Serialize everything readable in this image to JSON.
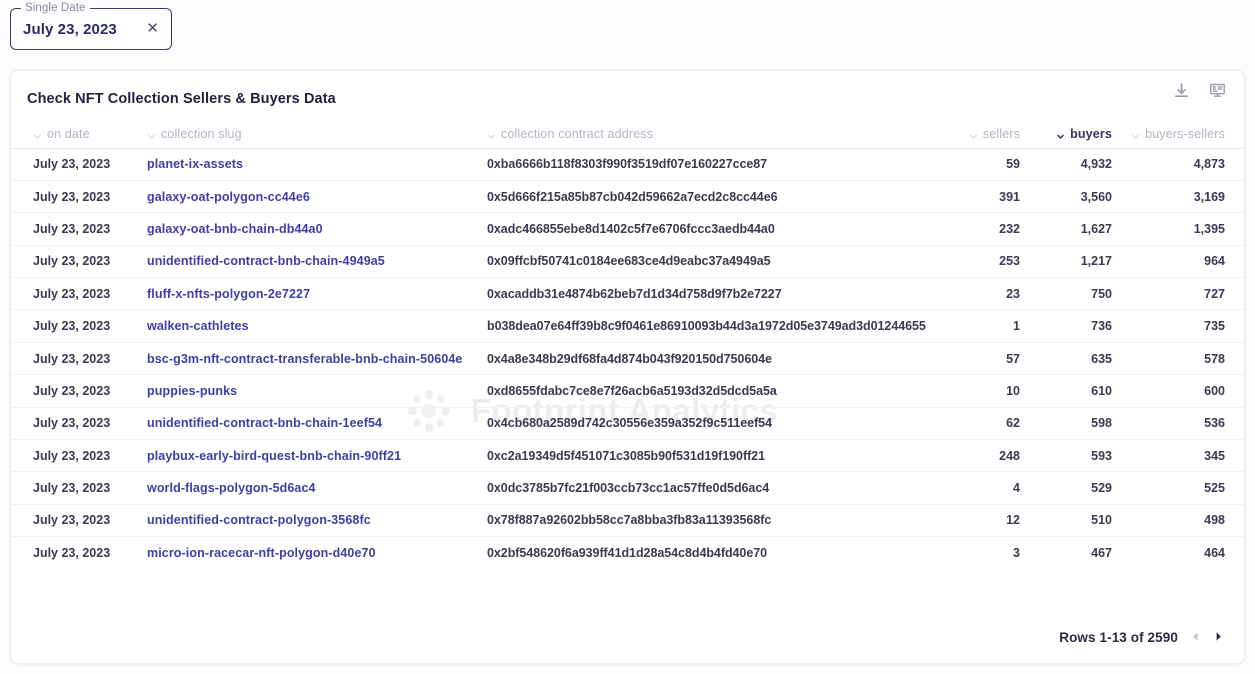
{
  "date_filter": {
    "label": "Single Date",
    "value": "July 23, 2023",
    "clear_icon": "close-icon"
  },
  "card": {
    "title": "Check NFT Collection Sellers & Buyers Data",
    "actions": [
      {
        "name": "download-icon",
        "title": "Download"
      },
      {
        "name": "api-screen-icon",
        "title": "API"
      }
    ]
  },
  "table": {
    "columns": [
      {
        "key": "on_date",
        "label": "on date",
        "align": "left",
        "sorted": false
      },
      {
        "key": "collection_slug",
        "label": "collection slug",
        "align": "left",
        "sorted": false
      },
      {
        "key": "collection_contract_address",
        "label": "collection contract address",
        "align": "left",
        "sorted": false
      },
      {
        "key": "sellers",
        "label": "sellers",
        "align": "right",
        "sorted": false
      },
      {
        "key": "buyers",
        "label": "buyers",
        "align": "right",
        "sorted": true
      },
      {
        "key": "buyers_sellers",
        "label": "buyers-sellers",
        "align": "right",
        "sorted": false
      }
    ],
    "rows": [
      {
        "on_date": "July 23, 2023",
        "collection_slug": "planet-ix-assets",
        "collection_contract_address": "0xba6666b118f8303f990f3519df07e160227cce87",
        "sellers": "59",
        "buyers": "4,932",
        "buyers_sellers": "4,873"
      },
      {
        "on_date": "July 23, 2023",
        "collection_slug": "galaxy-oat-polygon-cc44e6",
        "collection_contract_address": "0x5d666f215a85b87cb042d59662a7ecd2c8cc44e6",
        "sellers": "391",
        "buyers": "3,560",
        "buyers_sellers": "3,169"
      },
      {
        "on_date": "July 23, 2023",
        "collection_slug": "galaxy-oat-bnb-chain-db44a0",
        "collection_contract_address": "0xadc466855ebe8d1402c5f7e6706fccc3aedb44a0",
        "sellers": "232",
        "buyers": "1,627",
        "buyers_sellers": "1,395"
      },
      {
        "on_date": "July 23, 2023",
        "collection_slug": "unidentified-contract-bnb-chain-4949a5",
        "collection_contract_address": "0x09ffcbf50741c0184ee683ce4d9eabc37a4949a5",
        "sellers": "253",
        "buyers": "1,217",
        "buyers_sellers": "964"
      },
      {
        "on_date": "July 23, 2023",
        "collection_slug": "fluff-x-nfts-polygon-2e7227",
        "collection_contract_address": "0xacaddb31e4874b62beb7d1d34d758d9f7b2e7227",
        "sellers": "23",
        "buyers": "750",
        "buyers_sellers": "727"
      },
      {
        "on_date": "July 23, 2023",
        "collection_slug": "walken-cathletes",
        "collection_contract_address": "b038dea07e64ff39b8c9f0461e86910093b44d3a1972d05e3749ad3d01244655",
        "sellers": "1",
        "buyers": "736",
        "buyers_sellers": "735"
      },
      {
        "on_date": "July 23, 2023",
        "collection_slug": "bsc-g3m-nft-contract-transferable-bnb-chain-50604e",
        "collection_contract_address": "0x4a8e348b29df68fa4d874b043f920150d750604e",
        "sellers": "57",
        "buyers": "635",
        "buyers_sellers": "578"
      },
      {
        "on_date": "July 23, 2023",
        "collection_slug": "puppies-punks",
        "collection_contract_address": "0xd8655fdabc7ce8e7f26acb6a5193d32d5dcd5a5a",
        "sellers": "10",
        "buyers": "610",
        "buyers_sellers": "600"
      },
      {
        "on_date": "July 23, 2023",
        "collection_slug": "unidentified-contract-bnb-chain-1eef54",
        "collection_contract_address": "0x4cb680a2589d742c30556e359a352f9c511eef54",
        "sellers": "62",
        "buyers": "598",
        "buyers_sellers": "536"
      },
      {
        "on_date": "July 23, 2023",
        "collection_slug": "playbux-early-bird-quest-bnb-chain-90ff21",
        "collection_contract_address": "0xc2a19349d5f451071c3085b90f531d19f190ff21",
        "sellers": "248",
        "buyers": "593",
        "buyers_sellers": "345"
      },
      {
        "on_date": "July 23, 2023",
        "collection_slug": "world-flags-polygon-5d6ac4",
        "collection_contract_address": "0x0dc3785b7fc21f003ccb73cc1ac57ffe0d5d6ac4",
        "sellers": "4",
        "buyers": "529",
        "buyers_sellers": "525"
      },
      {
        "on_date": "July 23, 2023",
        "collection_slug": "unidentified-contract-polygon-3568fc",
        "collection_contract_address": "0x78f887a92602bb58cc7a8bba3fb83a11393568fc",
        "sellers": "12",
        "buyers": "510",
        "buyers_sellers": "498"
      },
      {
        "on_date": "July 23, 2023",
        "collection_slug": "micro-ion-racecar-nft-polygon-d40e70",
        "collection_contract_address": "0x2bf548620f6a939ff41d1d28a54c8d4b4fd40e70",
        "sellers": "3",
        "buyers": "467",
        "buyers_sellers": "464"
      }
    ]
  },
  "watermark": {
    "text": "Footprint Analytics",
    "logo_icon": "sunburst-logo-icon"
  },
  "footer": {
    "rows_label": "Rows 1-13 of 2590",
    "prev_icon": "chevron-left-icon",
    "next_icon": "chevron-right-icon"
  },
  "colors": {
    "link": "#3e3ea8",
    "accent": "#3b3b6d",
    "text": "#3a3a50",
    "muted": "#b3b3c4",
    "card_bg": "#ffffff",
    "page_bg": "#fbfbfc"
  }
}
